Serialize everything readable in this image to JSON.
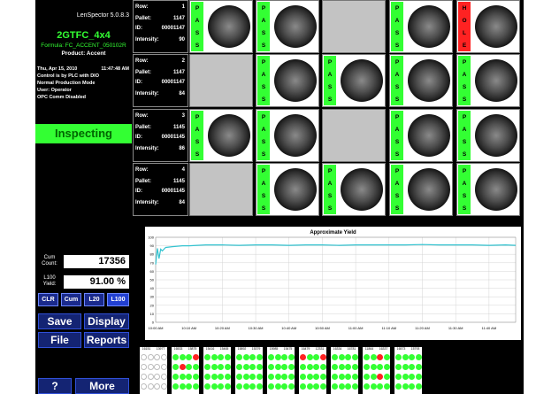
{
  "app": {
    "version": "LenSpector 5.0.8.3",
    "recipe": "2GTFC_4x4",
    "formula": "Formula:  FC_ACCENT_050102R",
    "product": "Product:  Accent",
    "date": "Thu, Apr 15, 2010",
    "time": "11:47:48 AM",
    "control": "Control is by PLC with DIO",
    "mode": "Normal Production Mode",
    "user": "User:  Operator",
    "opc": "OPC Comm Disabled",
    "status": "Inspecting"
  },
  "counts": {
    "cum_label": "Cum\nCount:",
    "cum_value": "17356",
    "yield_label": "L100\nYield:",
    "yield_value": "91.00 %"
  },
  "buttons": {
    "clr": "CLR",
    "cum": "Cum",
    "l20": "L20",
    "l100": "L100",
    "save": "Save",
    "display": "Display",
    "file": "File",
    "reports": "Reports",
    "help": "?",
    "more": "More"
  },
  "rows": [
    {
      "row_label": "Row:",
      "row": "1",
      "pallet_label": "Pallet:",
      "pallet": "1147",
      "id_label": "ID:",
      "id": "00001147",
      "int_label": "Intensity:",
      "intensity": "90",
      "cells": [
        {
          "tag": "PASS",
          "state": "pass"
        },
        {
          "tag": "PASS",
          "state": "pass"
        },
        {
          "tag": "",
          "state": "empty"
        },
        {
          "tag": "PASS",
          "state": "pass"
        },
        {
          "tag": "HOLE",
          "state": "hole"
        }
      ]
    },
    {
      "row_label": "Row:",
      "row": "2",
      "pallet_label": "Pallet:",
      "pallet": "1147",
      "id_label": "ID:",
      "id": "00001147",
      "int_label": "Intensity:",
      "intensity": "84",
      "cells": [
        {
          "tag": "",
          "state": "empty"
        },
        {
          "tag": "PASS",
          "state": "pass"
        },
        {
          "tag": "PASS",
          "state": "pass"
        },
        {
          "tag": "PASS",
          "state": "pass"
        },
        {
          "tag": "PASS",
          "state": "pass"
        }
      ]
    },
    {
      "row_label": "Row:",
      "row": "3",
      "pallet_label": "Pallet:",
      "pallet": "1145",
      "id_label": "ID:",
      "id": "00001145",
      "int_label": "Intensity:",
      "intensity": "86",
      "cells": [
        {
          "tag": "PASS",
          "state": "pass"
        },
        {
          "tag": "PASS",
          "state": "pass"
        },
        {
          "tag": "",
          "state": "empty"
        },
        {
          "tag": "PASS",
          "state": "pass"
        },
        {
          "tag": "PASS",
          "state": "pass"
        }
      ]
    },
    {
      "row_label": "Row:",
      "row": "4",
      "pallet_label": "Pallet:",
      "pallet": "1145",
      "id_label": "ID:",
      "id": "00001145",
      "int_label": "Intensity:",
      "intensity": "84",
      "cells": [
        {
          "tag": "",
          "state": "empty"
        },
        {
          "tag": "PASS",
          "state": "pass"
        },
        {
          "tag": "PASS",
          "state": "pass"
        },
        {
          "tag": "PASS",
          "state": "pass"
        },
        {
          "tag": "PASS",
          "state": "pass"
        }
      ]
    }
  ],
  "colors": {
    "pass": "#33ff33",
    "hole": "#ff2222",
    "empty": "#c3c3c3",
    "button": "#1a2a8c",
    "line": "#33c3d0"
  },
  "chart_data": {
    "type": "line",
    "title": "Approximate Yield",
    "ylim": [
      0,
      100
    ],
    "yticks": [
      "100",
      "90",
      "80",
      "70",
      "60",
      "50",
      "40",
      "30",
      "20",
      "10",
      "0"
    ],
    "xticks": [
      "10:00 AM",
      "10:10 AM",
      "10:20 AM",
      "10:30 AM",
      "10:40 AM",
      "10:50 AM",
      "11:00 AM",
      "11:10 AM",
      "11:20 AM",
      "11:30 AM",
      "11:40 AM"
    ],
    "x_range_min": [
      0,
      108
    ],
    "grid": true,
    "series": [
      {
        "x": [
          0,
          0.5,
          1,
          1.5,
          2,
          3,
          5,
          8,
          10,
          15,
          20,
          25,
          30,
          35,
          40,
          45,
          50,
          55,
          60,
          65,
          70,
          75,
          80,
          85,
          90,
          95,
          100,
          105,
          108
        ],
        "values": [
          68,
          87,
          75,
          86,
          84,
          88,
          89,
          90,
          90,
          91,
          91,
          90.5,
          91,
          91,
          90.5,
          91,
          91,
          90.5,
          91,
          91,
          91,
          91,
          91.5,
          91,
          91,
          91,
          90.5,
          91,
          90.5
        ]
      }
    ]
  },
  "trays": [
    {
      "a": "16151",
      "b": "13977",
      "pattern": [
        "w",
        "w",
        "w",
        "w",
        "w",
        "w",
        "w",
        "w",
        "w",
        "w",
        "w",
        "w",
        "w",
        "w",
        "w",
        "w"
      ]
    },
    {
      "a": "16533",
      "b": "15875",
      "pattern": [
        "g",
        "g",
        "g",
        "r",
        "g",
        "r",
        "g",
        "g",
        "g",
        "g",
        "g",
        "g",
        "g",
        "g",
        "g",
        "g"
      ]
    },
    {
      "a": "15416",
      "b": "15465",
      "pattern": [
        "g",
        "g",
        "g",
        "g",
        "g",
        "g",
        "g",
        "g",
        "g",
        "g",
        "g",
        "g",
        "g",
        "g",
        "g",
        "g"
      ]
    },
    {
      "a": "15892",
      "b": "15379",
      "pattern": [
        "g",
        "g",
        "g",
        "g",
        "g",
        "g",
        "g",
        "g",
        "g",
        "g",
        "g",
        "g",
        "g",
        "g",
        "g",
        "g"
      ]
    },
    {
      "a": "15985",
      "b": "15475",
      "pattern": [
        "g",
        "g",
        "g",
        "g",
        "g",
        "g",
        "g",
        "g",
        "g",
        "g",
        "g",
        "g",
        "g",
        "g",
        "g",
        "g"
      ]
    },
    {
      "a": "16479",
      "b": "12331",
      "pattern": [
        "r",
        "g",
        "g",
        "r",
        "g",
        "g",
        "g",
        "g",
        "g",
        "g",
        "g",
        "g",
        "g",
        "g",
        "g",
        "g"
      ]
    },
    {
      "a": "16334",
      "b": "16781",
      "pattern": [
        "g",
        "g",
        "g",
        "g",
        "g",
        "g",
        "g",
        "g",
        "g",
        "g",
        "g",
        "g",
        "g",
        "g",
        "g",
        "g"
      ]
    },
    {
      "a": "11864",
      "b": "16337",
      "pattern": [
        "g",
        "g",
        "r",
        "g",
        "g",
        "g",
        "g",
        "g",
        "g",
        "g",
        "r",
        "g",
        "g",
        "g",
        "g",
        "g"
      ]
    },
    {
      "a": "16573",
      "b": "15793",
      "pattern": [
        "g",
        "g",
        "g",
        "g",
        "g",
        "g",
        "g",
        "g",
        "g",
        "g",
        "g",
        "g",
        "g",
        "g",
        "g",
        "g"
      ]
    }
  ]
}
